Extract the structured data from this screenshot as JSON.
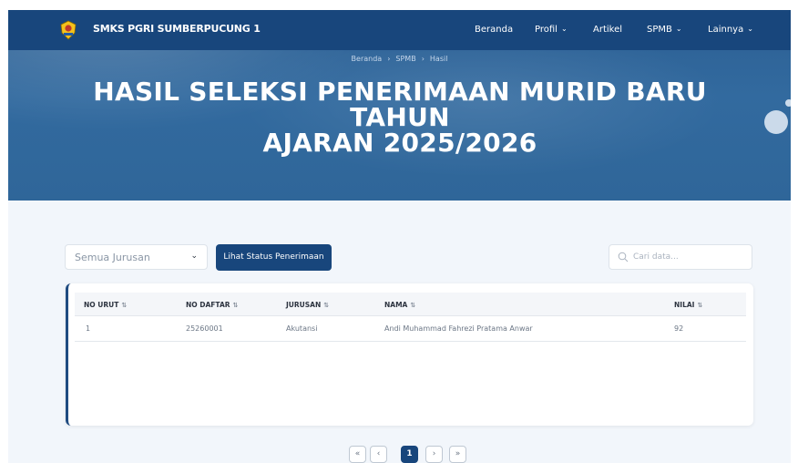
{
  "navbar": {
    "brand": "SMKS PGRI SUMBERPUCUNG 1",
    "logo_icon": "school-emblem-icon",
    "items": [
      {
        "label": "Beranda",
        "has_dropdown": false
      },
      {
        "label": "Profil",
        "has_dropdown": true
      },
      {
        "label": "Artikel",
        "has_dropdown": false
      },
      {
        "label": "SPMB",
        "has_dropdown": true
      },
      {
        "label": "Lainnya",
        "has_dropdown": true
      }
    ]
  },
  "breadcrumb": [
    "Beranda",
    "SPMB",
    "Hasil"
  ],
  "breadcrumb_separator": "›",
  "hero": {
    "title_line1": "HASIL SELEKSI PENERIMAAN MURID BARU TAHUN",
    "title_line2": "AJARAN 2025/2026"
  },
  "filters": {
    "jurusan_selected": "Semua Jurusan",
    "status_button": "Lihat Status Penerimaan",
    "search_placeholder": "Cari data..."
  },
  "table": {
    "sort_glyph": "⇅",
    "columns": [
      "NO URUT",
      "NO DAFTAR",
      "JURUSAN",
      "NAMA",
      "NILAI"
    ],
    "rows": [
      [
        "1",
        "25260001",
        "Akutansi",
        "Andi Muhammad Fahrezi Pratama Anwar",
        "92"
      ]
    ]
  },
  "pagination": {
    "first": "«",
    "prev": "‹",
    "current": "1",
    "next": "›",
    "last": "»"
  },
  "colors": {
    "navbar": "#18467c",
    "hero": "#326a9f",
    "accent": "#18467c",
    "page_bg": "#f2f6fb"
  }
}
